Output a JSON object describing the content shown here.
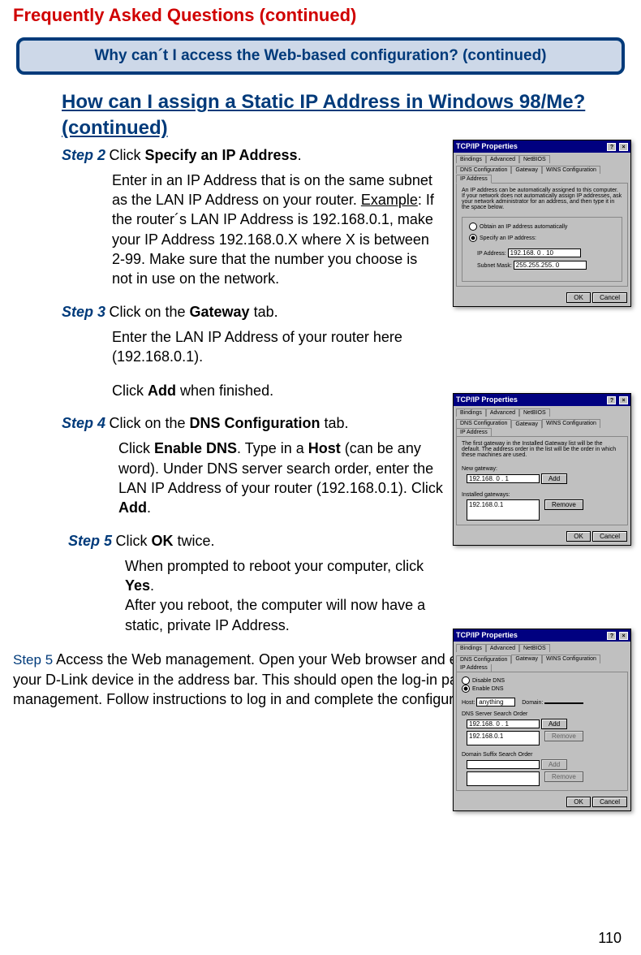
{
  "page": {
    "title": "Frequently Asked Questions (continued)",
    "callout": "Why can´t I access the Web-based configuration? (continued)",
    "subheading": "How can I assign a Static IP Address in Windows 98/Me?  (continued)",
    "pageNumber": "110"
  },
  "steps": {
    "s2": {
      "label": "Step 2",
      "line": "Click ",
      "bold": "Specify an IP Address",
      "after": ".",
      "body_pre": "Enter in an IP Address that is on the same subnet as the LAN IP Address on your router. ",
      "body_uline": "Example",
      "body_post": ": If the router´s LAN IP Address is 192.168.0.1, make your IP Address 192.168.0.X where X is between 2-99. Make sure that the number you choose is not in use on the network."
    },
    "s3": {
      "label": "Step 3",
      "line": "Click on the ",
      "bold": "Gateway",
      "after": " tab.",
      "body1": "Enter the LAN IP Address of your router here (192.168.0.1).",
      "body2_pre": "Click ",
      "body2_bold": "Add",
      "body2_post": " when finished."
    },
    "s4": {
      "label": "Step 4",
      "line": "Click on the ",
      "bold": "DNS Configuration",
      "after": " tab.",
      "body_pre": "Click ",
      "b1": "Enable DNS",
      "mid1": ". Type in a ",
      "b2": "Host",
      "mid2": " (can be any word). Under DNS server search order, enter the LAN IP Address of your router (192.168.0.1). Click ",
      "b3": "Add",
      "post": "."
    },
    "s5": {
      "label": "Step 5",
      "line": "Click ",
      "bold": "OK",
      "after": " twice.",
      "body1_pre": "When prompted to reboot your computer, click ",
      "body1_bold": "Yes",
      "body1_post": ".",
      "body2": "After you reboot, the computer will now have a static, private IP Address."
    },
    "final": {
      "label": "Step 5",
      "text": " Access the Web management. Open your Web browser and enter the IP Address of your D-Link device in the address bar. This should open the log-in page for the web management. Follow instructions to log in and complete the configuration."
    }
  },
  "dialogs": {
    "title": "TCP/IP Properties",
    "help": "?",
    "close": "×",
    "tabs": {
      "bindings": "Bindings",
      "advanced": "Advanced",
      "netbios": "NetBIOS",
      "dns": "DNS Configuration",
      "gateway": "Gateway",
      "wins": "WINS Configuration",
      "ip": "IP Address"
    },
    "ok": "OK",
    "cancel": "Cancel",
    "d1": {
      "intro": "An IP address can be automatically assigned to this computer. If your network does not automatically assign IP addresses, ask your network administrator for an address, and then type it in the space below.",
      "opt1": "Obtain an IP address automatically",
      "opt2": "Specify an IP address:",
      "ipLabel": "IP Address:",
      "ipVal": "192.168. 0 . 10",
      "maskLabel": "Subnet Mask:",
      "maskVal": "255.255.255. 0"
    },
    "d2": {
      "intro": "The first gateway in the Installed Gateway list will be the default. The address order in the list will be the order in which these machines are used.",
      "newgw": "New gateway:",
      "newgwVal": "192.168. 0 . 1",
      "add": "Add",
      "installed": "Installed gateways:",
      "listVal": "192.168.0.1",
      "remove": "Remove"
    },
    "d3": {
      "disable": "Disable DNS",
      "enable": "Enable DNS",
      "hostLabel": "Host:",
      "hostVal": "anything",
      "domainLabel": "Domain:",
      "searchOrder": "DNS Server Search Order",
      "searchVal": "192.168. 0 . 1",
      "add": "Add",
      "listVal": "192.168.0.1",
      "remove": "Remove",
      "suffix": "Domain Suffix Search Order",
      "add2": "Add",
      "remove2": "Remove"
    }
  }
}
